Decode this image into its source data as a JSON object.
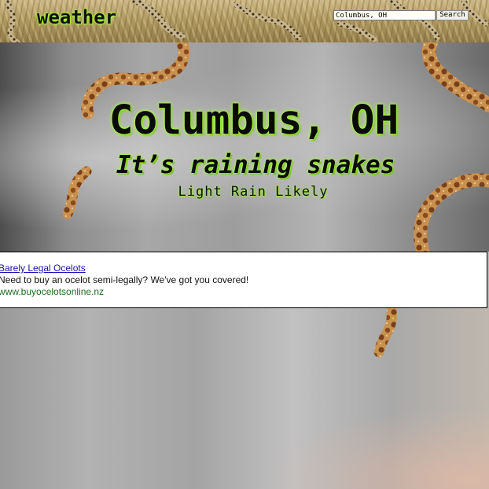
{
  "header": {
    "logo": "weather",
    "search": {
      "value": "Columbus, OH",
      "button_label": "Search"
    }
  },
  "hero": {
    "city": "Columbus, OH",
    "headline": "It’s raining snakes",
    "condition": "Light Rain Likely"
  },
  "ad": {
    "title": "Barely Legal Ocelots",
    "description": "Need to buy an ocelot semi-legally? We've got you covered!",
    "url": "www.buyocelotsonline.nz"
  },
  "colors": {
    "text_glow": "#a6ff3a",
    "ad_link": "#1a0dab",
    "ad_url": "#1c6c22",
    "snake_body": "#c48a4a",
    "snake_spots": "#7a3f18"
  },
  "icons": {
    "decorations": [
      "lizard-image",
      "snake-image"
    ]
  }
}
